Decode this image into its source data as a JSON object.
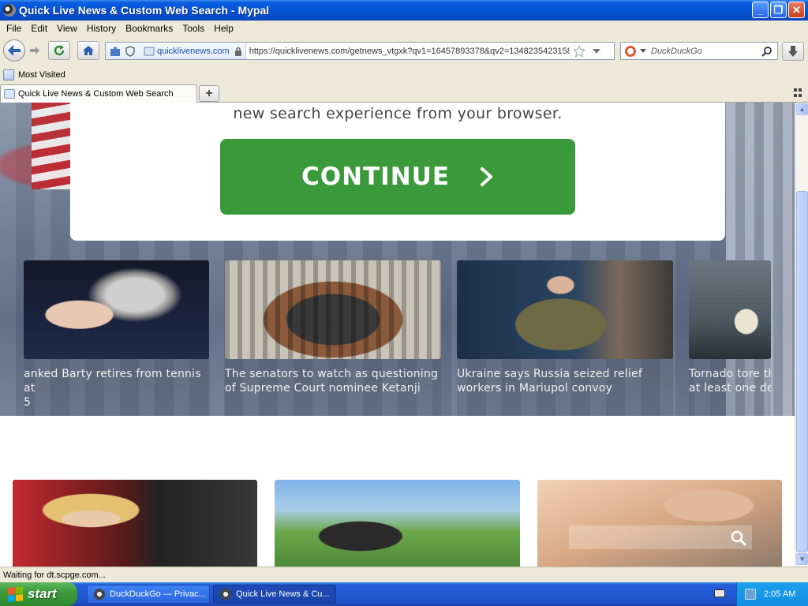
{
  "window": {
    "title": "Quick Live News & Custom Web Search - Mypal",
    "buttons": {
      "minimize": "_",
      "maximize": "❐",
      "close": "✕"
    }
  },
  "menu": [
    "File",
    "Edit",
    "View",
    "History",
    "Bookmarks",
    "Tools",
    "Help"
  ],
  "nav": {
    "identity_domain": "quicklivenews.com",
    "url": "https://quicklivenews.com/getnews_vtgxk?qv1=16457893378&qv2=1348235423158",
    "search_placeholder": "DuckDuckGo"
  },
  "bookmarks": {
    "most_visited": "Most Visited"
  },
  "tabs": [
    {
      "label": "Quick Live News & Custom Web Search"
    }
  ],
  "page": {
    "panel_text": "new search experience from your browser.",
    "continue_label": "CONTINUE",
    "news": [
      {
        "caption_line1": "anked Barty retires from tennis at",
        "caption_line2": "5"
      },
      {
        "caption_line1": "The senators to watch as questioning",
        "caption_line2": "of Supreme Court nominee Ketanji"
      },
      {
        "caption_line1": "Ukraine says Russia seized relief",
        "caption_line2": "workers in Mariupol convoy"
      },
      {
        "caption_line1": "Tornado tore th",
        "caption_line2": "at least one de"
      }
    ]
  },
  "status": {
    "text": "Waiting for dt.scpge.com..."
  },
  "taskbar": {
    "start_label": "start",
    "items": [
      {
        "label": "DuckDuckGo — Privac..."
      },
      {
        "label": "Quick Live News & Cu..."
      }
    ],
    "clock": "2:05 AM"
  },
  "colors": {
    "continue_green": "#3a9a3a",
    "xp_blue": "#0552d6",
    "taskbar_blue": "#2257d3"
  }
}
